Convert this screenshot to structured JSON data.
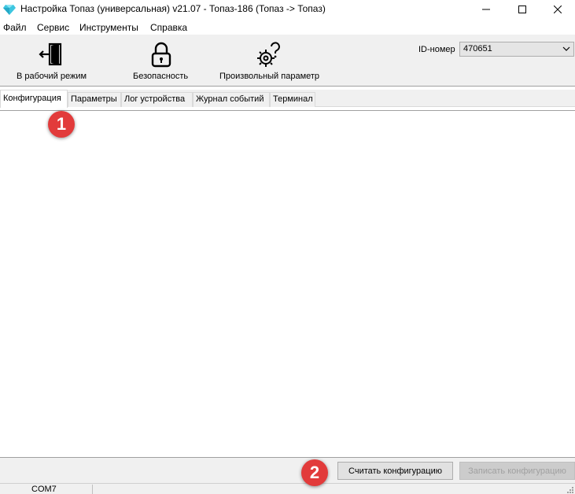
{
  "window": {
    "title": "Настройка Топаз (универсальная) v21.07 - Топаз-186 (Топаз -> Топаз)"
  },
  "menu": [
    "Файл",
    "Сервис",
    "Инструменты",
    "Справка"
  ],
  "toolbar": {
    "work_mode_label": "В рабочий режим",
    "security_label": "Безопасность",
    "custom_param_label": "Произвольный параметр"
  },
  "id_number": {
    "label": "ID-номер",
    "value": "470651"
  },
  "tabs": [
    "Конфигурация",
    "Параметры",
    "Лог устройства",
    "Журнал событий",
    "Терминал"
  ],
  "active_tab": "Конфигурация",
  "actions": {
    "read_config_label": "Считать конфигурацию",
    "write_config_label": "Записать конфигурацию"
  },
  "status": {
    "port": "COM7"
  },
  "annotations": [
    "1",
    "2"
  ],
  "colors": {
    "badge": "#e23b3b",
    "toolbar_bg": "#f0f0f0",
    "app_icon": "#3ec6e0"
  }
}
